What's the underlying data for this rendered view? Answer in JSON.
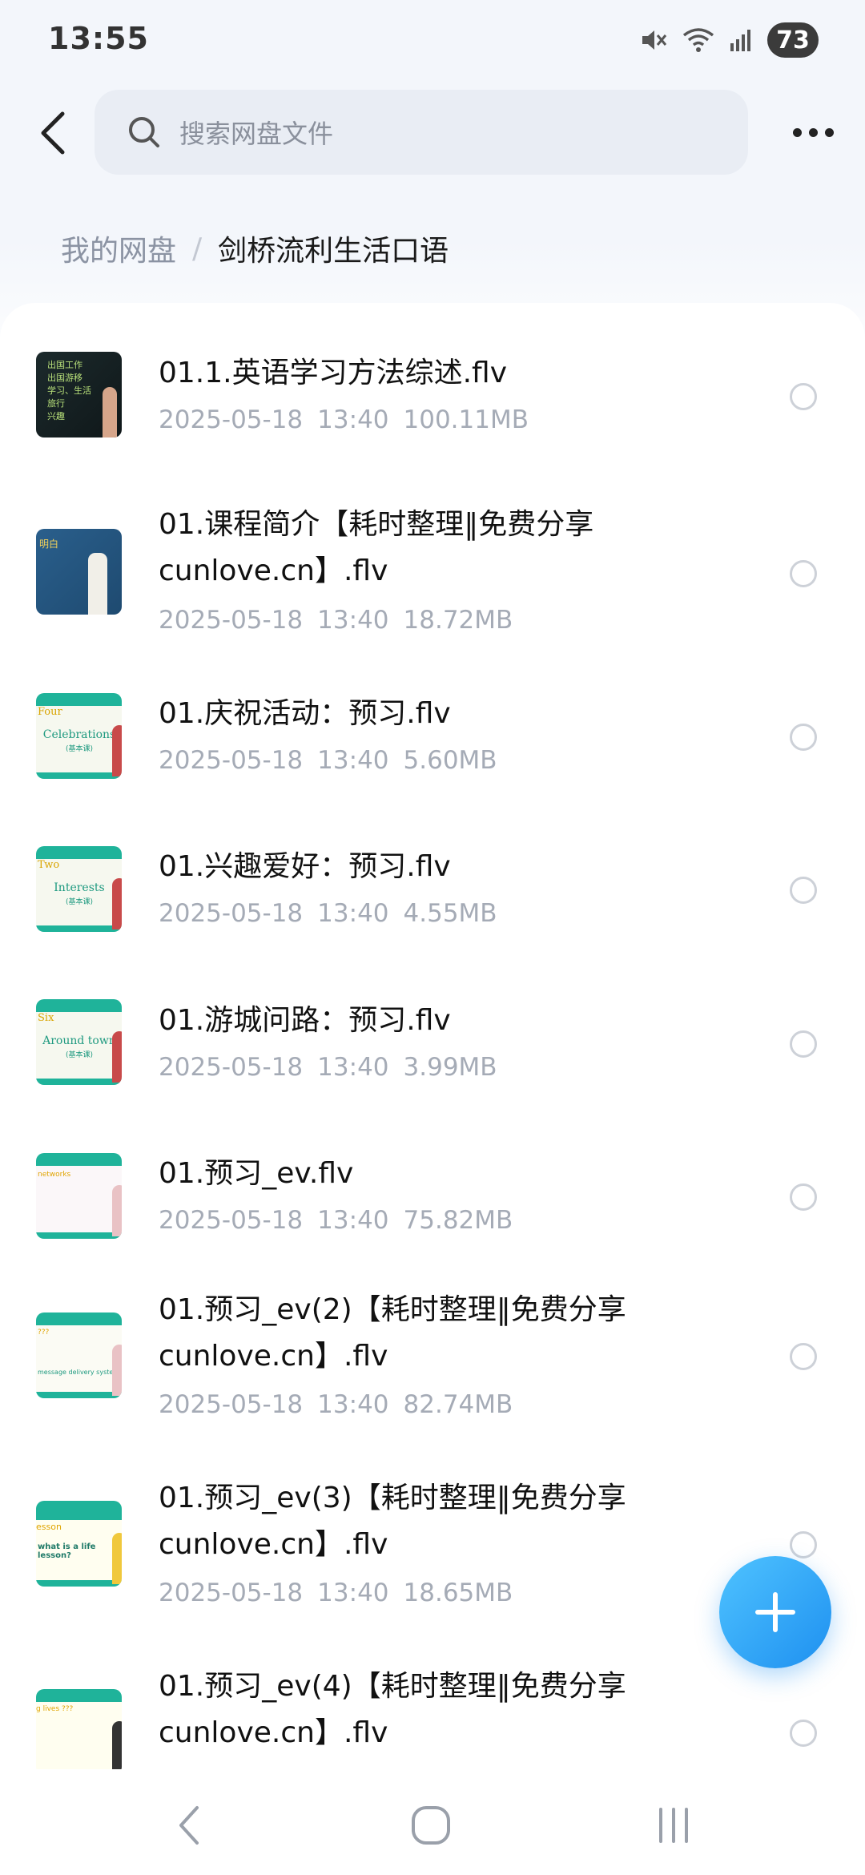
{
  "status_bar": {
    "time": "13:55",
    "battery": "73",
    "icons": [
      "mute-icon",
      "wifi-icon",
      "signal-icon"
    ]
  },
  "search": {
    "placeholder": "搜索网盘文件"
  },
  "breadcrumb": {
    "root": "我的网盘",
    "separator": "/",
    "current": "剑桥流利生活口语"
  },
  "files": [
    {
      "name": "01.1.英语学习方法综述.flv",
      "date": "2025-05-18",
      "time": "13:40",
      "size": "100.11MB",
      "thumb_icon": "video-thumbnail"
    },
    {
      "name": "01.课程简介【耗时整理‖免费分享cunlove.cn】.flv",
      "date": "2025-05-18",
      "time": "13:40",
      "size": "18.72MB",
      "thumb_icon": "video-thumbnail"
    },
    {
      "name": "01.庆祝活动：预习.flv",
      "date": "2025-05-18",
      "time": "13:40",
      "size": "5.60MB",
      "thumb_icon": "video-thumbnail"
    },
    {
      "name": "01.兴趣爱好：预习.flv",
      "date": "2025-05-18",
      "time": "13:40",
      "size": "4.55MB",
      "thumb_icon": "video-thumbnail"
    },
    {
      "name": "01.游城问路：预习.flv",
      "date": "2025-05-18",
      "time": "13:40",
      "size": "3.99MB",
      "thumb_icon": "video-thumbnail"
    },
    {
      "name": "01.预习_ev.flv",
      "date": "2025-05-18",
      "time": "13:40",
      "size": "75.82MB",
      "thumb_icon": "video-thumbnail"
    },
    {
      "name": "01.预习_ev(2)【耗时整理‖免费分享cunlove.cn】.flv",
      "date": "2025-05-18",
      "time": "13:40",
      "size": "82.74MB",
      "thumb_icon": "video-thumbnail"
    },
    {
      "name": "01.预习_ev(3)【耗时整理‖免费分享cunlove.cn】.flv",
      "date": "2025-05-18",
      "time": "13:40",
      "size": "18.65MB",
      "thumb_icon": "video-thumbnail"
    },
    {
      "name": "01.预习_ev(4)【耗时整理‖免费分享cunlove.cn】.flv",
      "date": "",
      "time": "",
      "size": "",
      "thumb_icon": "video-thumbnail"
    }
  ],
  "thumb_text": {
    "t0": [
      "出国工作",
      "出国游移",
      "学习、生活",
      "旅行",
      "兴趣"
    ],
    "t1": "明白",
    "t2": [
      "Four",
      "Celebrations",
      "(基本课)"
    ],
    "t3": [
      "Two",
      "Interests",
      "(基本课)"
    ],
    "t4": [
      "Six",
      "Around town",
      "(基本课)"
    ],
    "t5": "networks",
    "t6": [
      "???",
      "message delivery system"
    ],
    "t7": [
      "esson",
      "what is a life lesson?"
    ],
    "t8": "g lives ???"
  },
  "nav_bar": {
    "icons": [
      "back-nav-icon",
      "home-nav-icon",
      "recents-nav-icon"
    ]
  },
  "colors": {
    "accent": "#1e90f0",
    "search_bg": "#e9edf4",
    "meta_text": "#a5abb6",
    "thumb_teal": "#1fb39a"
  }
}
